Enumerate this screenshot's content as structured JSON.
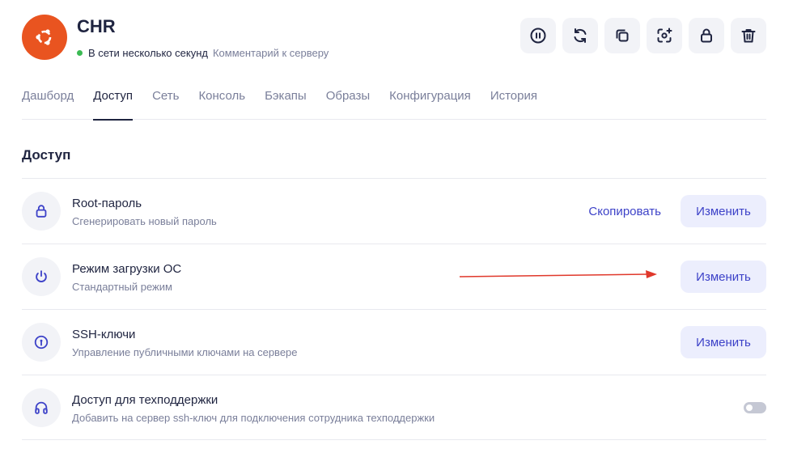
{
  "colors": {
    "accent": "#e95420",
    "online": "#3cba54",
    "primary": "#3d42c8",
    "arrow": "#e0382b"
  },
  "server": {
    "name": "CHR",
    "logo_icon": "ubuntu-logo-icon",
    "status": "В сети несколько секунд",
    "comment_link": "Комментарий к серверу"
  },
  "toolbar": [
    {
      "name": "pause-icon"
    },
    {
      "name": "reboot-icon"
    },
    {
      "name": "clone-icon"
    },
    {
      "name": "snapshot-icon"
    },
    {
      "name": "lock-icon"
    },
    {
      "name": "trash-icon"
    }
  ],
  "tabs": [
    {
      "label": "Дашборд",
      "active": false
    },
    {
      "label": "Доступ",
      "active": true
    },
    {
      "label": "Сеть",
      "active": false
    },
    {
      "label": "Консоль",
      "active": false
    },
    {
      "label": "Бэкапы",
      "active": false
    },
    {
      "label": "Образы",
      "active": false
    },
    {
      "label": "Конфигурация",
      "active": false
    },
    {
      "label": "История",
      "active": false
    }
  ],
  "section": {
    "title": "Доступ"
  },
  "rows": [
    {
      "icon": "lock-icon",
      "title": "Root-пароль",
      "subtitle": "Сгенерировать новый пароль",
      "copy_label": "Скопировать",
      "button_label": "Изменить"
    },
    {
      "icon": "power-icon",
      "title": "Режим загрузки ОС",
      "subtitle": "Стандартный режим",
      "button_label": "Изменить"
    },
    {
      "icon": "key-icon",
      "title": "SSH-ключи",
      "subtitle": "Управление публичными ключами на сервере",
      "button_label": "Изменить"
    },
    {
      "icon": "headphones-icon",
      "title": "Доступ для техподдержки",
      "subtitle": "Добавить на сервер ssh-ключ для подключения сотрудника техподдержки",
      "toggle_on": false
    }
  ]
}
